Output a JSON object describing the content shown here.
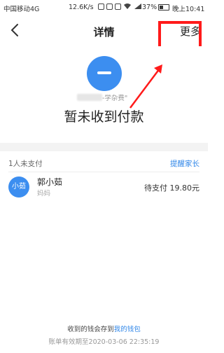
{
  "status_bar": {
    "carrier": "中国移动4G",
    "speed": "12.6K/s",
    "battery": "37%",
    "time": "晚上10:41"
  },
  "header": {
    "title": "详情",
    "more_label": "更多",
    "back_icon": "chevron-left-icon"
  },
  "summary": {
    "bill_name": "-学杂费\"",
    "status": "暂未收到付款"
  },
  "unpaid": {
    "count_label": "1人未支付",
    "remind_label": "提醒家长",
    "members": [
      {
        "avatar_text": "小茹",
        "name": "郭小茹",
        "relation": "妈妈",
        "status": "待支付 19.80元"
      }
    ]
  },
  "footer": {
    "note_prefix": "收到的钱会存到",
    "wallet_link": "我的钱包",
    "expiry": "账单有效期至2020-03-06 22:35:19"
  },
  "colors": {
    "accent": "#2f86e8",
    "avatar": "#3c8ef0",
    "annotation": "#ff1a1a"
  }
}
